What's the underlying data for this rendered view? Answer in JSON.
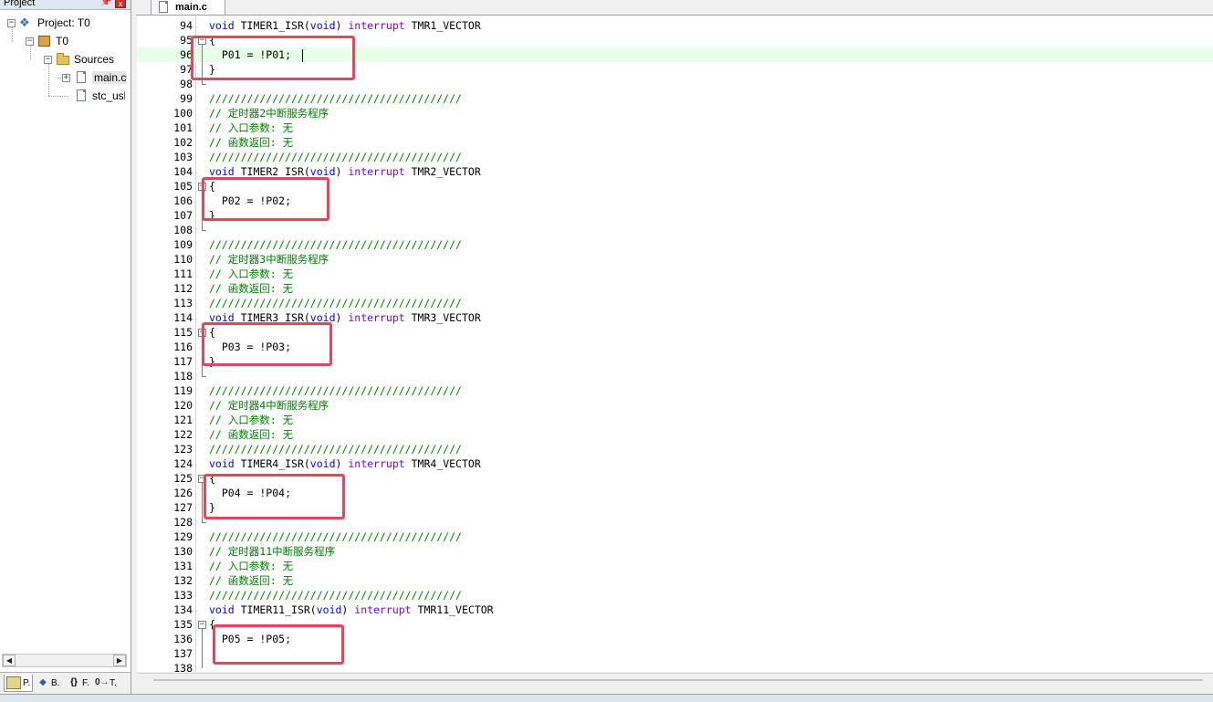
{
  "project_panel": {
    "title": "Project",
    "pin_glyph": "📌",
    "close_glyph": "x",
    "tree": {
      "project": "Project: T0",
      "target": "T0",
      "group": "Sources",
      "files": [
        "main.c",
        "stc_usb"
      ]
    },
    "tabs": [
      "P.",
      "B.",
      "F.",
      "T."
    ],
    "tab_icons": [
      "project-tab-icon",
      "books-tab-icon",
      "functions-tab-icon",
      "templates-tab-icon"
    ]
  },
  "editor": {
    "tab_label": "main.c",
    "current_line": "96",
    "highlight_color": "#e8445c",
    "lines": [
      {
        "n": "94",
        "t": "void TIMER1_ISR(void) interrupt TMR1_VECTOR"
      },
      {
        "n": "95",
        "t": "{"
      },
      {
        "n": "96",
        "t": "  P01 = !P01;"
      },
      {
        "n": "97",
        "t": "}"
      },
      {
        "n": "98",
        "t": ""
      },
      {
        "n": "99",
        "t": "////////////////////////////////////////"
      },
      {
        "n": "100",
        "t": "// 定时器2中断服务程序"
      },
      {
        "n": "101",
        "t": "// 入口参数: 无"
      },
      {
        "n": "102",
        "t": "// 函数返回: 无"
      },
      {
        "n": "103",
        "t": "////////////////////////////////////////"
      },
      {
        "n": "104",
        "t": "void TIMER2_ISR(void) interrupt TMR2_VECTOR"
      },
      {
        "n": "105",
        "t": "{"
      },
      {
        "n": "106",
        "t": "  P02 = !P02;"
      },
      {
        "n": "107",
        "t": "}"
      },
      {
        "n": "108",
        "t": ""
      },
      {
        "n": "109",
        "t": "////////////////////////////////////////"
      },
      {
        "n": "110",
        "t": "// 定时器3中断服务程序"
      },
      {
        "n": "111",
        "t": "// 入口参数: 无"
      },
      {
        "n": "112",
        "t": "// 函数返回: 无"
      },
      {
        "n": "113",
        "t": "////////////////////////////////////////"
      },
      {
        "n": "114",
        "t": "void TIMER3_ISR(void) interrupt TMR3_VECTOR"
      },
      {
        "n": "115",
        "t": "{"
      },
      {
        "n": "116",
        "t": "  P03 = !P03;"
      },
      {
        "n": "117",
        "t": "}"
      },
      {
        "n": "118",
        "t": ""
      },
      {
        "n": "119",
        "t": "////////////////////////////////////////"
      },
      {
        "n": "120",
        "t": "// 定时器4中断服务程序"
      },
      {
        "n": "121",
        "t": "// 入口参数: 无"
      },
      {
        "n": "122",
        "t": "// 函数返回: 无"
      },
      {
        "n": "123",
        "t": "////////////////////////////////////////"
      },
      {
        "n": "124",
        "t": "void TIMER4_ISR(void) interrupt TMR4_VECTOR"
      },
      {
        "n": "125",
        "t": "{"
      },
      {
        "n": "126",
        "t": "  P04 = !P04;"
      },
      {
        "n": "127",
        "t": "}"
      },
      {
        "n": "128",
        "t": ""
      },
      {
        "n": "129",
        "t": "////////////////////////////////////////"
      },
      {
        "n": "130",
        "t": "// 定时器11中断服务程序"
      },
      {
        "n": "131",
        "t": "// 入口参数: 无"
      },
      {
        "n": "132",
        "t": "// 函数返回: 无"
      },
      {
        "n": "133",
        "t": "////////////////////////////////////////"
      },
      {
        "n": "134",
        "t": "void TIMER11_ISR(void) interrupt TMR11_VECTOR"
      },
      {
        "n": "135",
        "t": "{"
      },
      {
        "n": "136",
        "t": "  P05 = !P05;"
      },
      {
        "n": "137",
        "t": ""
      },
      {
        "n": "138",
        "t": ""
      }
    ]
  }
}
